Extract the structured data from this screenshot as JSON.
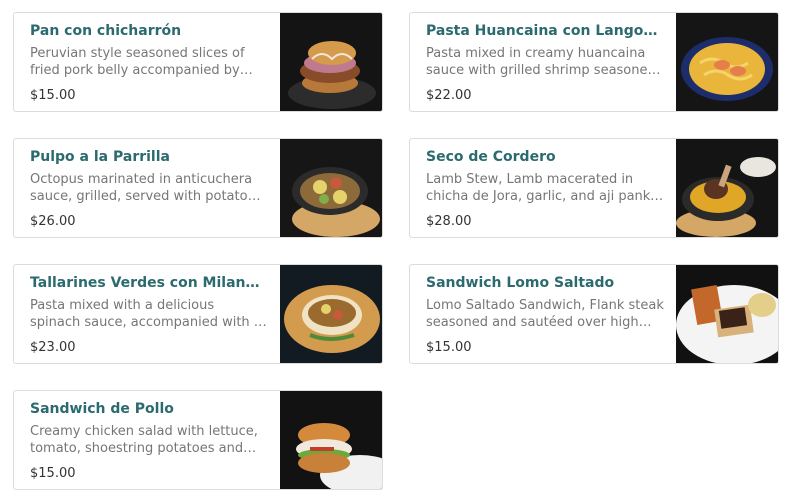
{
  "menu_items": [
    {
      "name": "Pan con chicharrón",
      "description": "Peruvian style seasoned slices of fried pork belly accompanied by sweet potato, salsa criolla and Peruvian sauce.",
      "price": "$15.00",
      "image": "sandwich-photo"
    },
    {
      "name": "Pasta Huancaina con Langostinos",
      "description": "Pasta mixed in creamy huancaina sauce with grilled shrimp seasoned in house spices.",
      "price": "$22.00",
      "image": "pasta-photo"
    },
    {
      "name": "Pulpo a la Parrilla",
      "description": "Octopus marinated in anticuchera sauce, grilled, served with potatoes and corn.",
      "price": "$26.00",
      "image": "octopus-skillet-photo"
    },
    {
      "name": "Seco de Cordero",
      "description": "Lamb Stew, Lamb macerated in chicha de Jora, garlic, and aji panka, served with rice.",
      "price": "$28.00",
      "image": "lamb-stew-photo"
    },
    {
      "name": "Tallarines Verdes con Milanesa",
      "description": "Pasta mixed with a delicious spinach sauce, accompanied with a juicy breaded steak.",
      "price": "$23.00",
      "image": "milanesa-photo"
    },
    {
      "name": "Sandwich Lomo Saltado",
      "description": "Lomo Saltado Sandwich, Flank steak seasoned and sautéed over high heat with onions and tomatoes.",
      "price": "$15.00",
      "image": "steak-sandwich-photo"
    },
    {
      "name": "Sandwich de Pollo",
      "description": "Creamy chicken salad with lettuce, tomato, shoestring potatoes and golden bread.",
      "price": "$15.00",
      "image": "chicken-sandwich-photo"
    }
  ]
}
